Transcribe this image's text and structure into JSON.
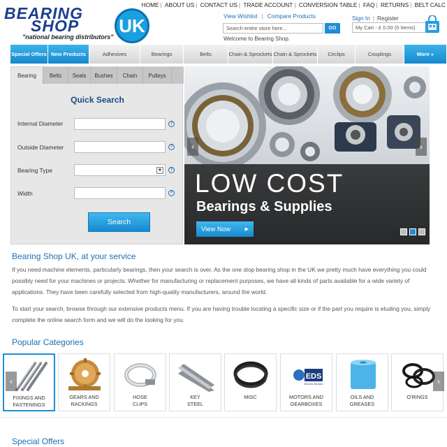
{
  "header": {
    "logo_line1": "BEARING",
    "logo_line2": "SHOP",
    "logo_badge": "UK",
    "tagline": "\"national bearing distributors\"",
    "top_links": [
      "HOME",
      "ABOUT US",
      "CONTACT US",
      "TRADE ACCOUNT",
      "CONVERSION TABLE",
      "FAQ",
      "RETURNS",
      "BELT CALC"
    ],
    "view_wishlist": "View Wishlist",
    "compare_products": "Compare Products",
    "sign_in": "Sign In",
    "register": "Register",
    "search_placeholder": "Search entire store here...",
    "search_go": "GO",
    "welcome": "Welcome to Bearing Shop.",
    "cart": "My Cart - £ 0.00 (0 Items)",
    "cart_icon": "shopping-bag-icon"
  },
  "nav": {
    "items": [
      {
        "label": "Special Offers",
        "highlight": true
      },
      {
        "label": "New Products",
        "highlight": true
      },
      {
        "label": "Adhesives",
        "highlight": false
      },
      {
        "label": "Bearings",
        "highlight": false
      },
      {
        "label": "Belts",
        "highlight": false
      },
      {
        "label": "Chain & Sprockets",
        "highlight": false
      },
      {
        "label": "Chain & Sprockets",
        "highlight": false
      },
      {
        "label": "Circlips",
        "highlight": false
      },
      {
        "label": "Couplings",
        "highlight": false
      }
    ],
    "more": "More »"
  },
  "quick_search": {
    "tabs": [
      "Bearing",
      "Belts",
      "Seals",
      "Bushes",
      "Chain",
      "Pulleys"
    ],
    "active_tab": "Bearing",
    "title": "Quick Search",
    "fields": [
      "Internal Diameter",
      "Outside Diameter",
      "Bearing Type",
      "Width"
    ],
    "help": "?",
    "button": "Search"
  },
  "banner": {
    "headline": "LOW COST",
    "subheadline": "Bearings & Supplies",
    "button": "View Now",
    "prev": "‹",
    "next": "›",
    "slides": 3,
    "active_slide": 2
  },
  "intro": {
    "title": "Bearing Shop UK, at your service",
    "p1": "If you need machine elements, particularly bearings, then your search is over. As the one stop bearing shop in the UK we pretty much have everything you could possibly need for your machines or projects. Whether for manufacturing or replacement purposes, we have all kinds of parts available for a wide variety of applications. They have been carefully selected from high-quality manufacturers, around the world.",
    "p2": "To start your search, browse through our extensive products menu.  If you are having trouble locating a specific size or if the part you require is eluding you, simply complete the online search form and we will do the looking for you."
  },
  "popular": {
    "title": "Popular Categories",
    "categories": [
      {
        "l1": "FIXINGS AND",
        "l2": "FASTENINGS"
      },
      {
        "l1": "GEARS AND",
        "l2": "RACKINGS"
      },
      {
        "l1": "HOSE",
        "l2": "CLIPS"
      },
      {
        "l1": "KEY",
        "l2": "STEEL"
      },
      {
        "l1": "MISC",
        "l2": ""
      },
      {
        "l1": "MOTORS AND",
        "l2": "GEARBOXES"
      },
      {
        "l1": "OILS AND",
        "l2": "GREASES"
      },
      {
        "l1": "O'RINGS",
        "l2": ""
      }
    ],
    "edrives_brand": "EDS",
    "edrives_sub": "Electric Motors"
  },
  "special_offers": {
    "title": "Special Offers"
  },
  "colors": {
    "accent": "#1d8ed8",
    "brand_navy": "#1b3f8f",
    "link": "#1a6fb5"
  }
}
